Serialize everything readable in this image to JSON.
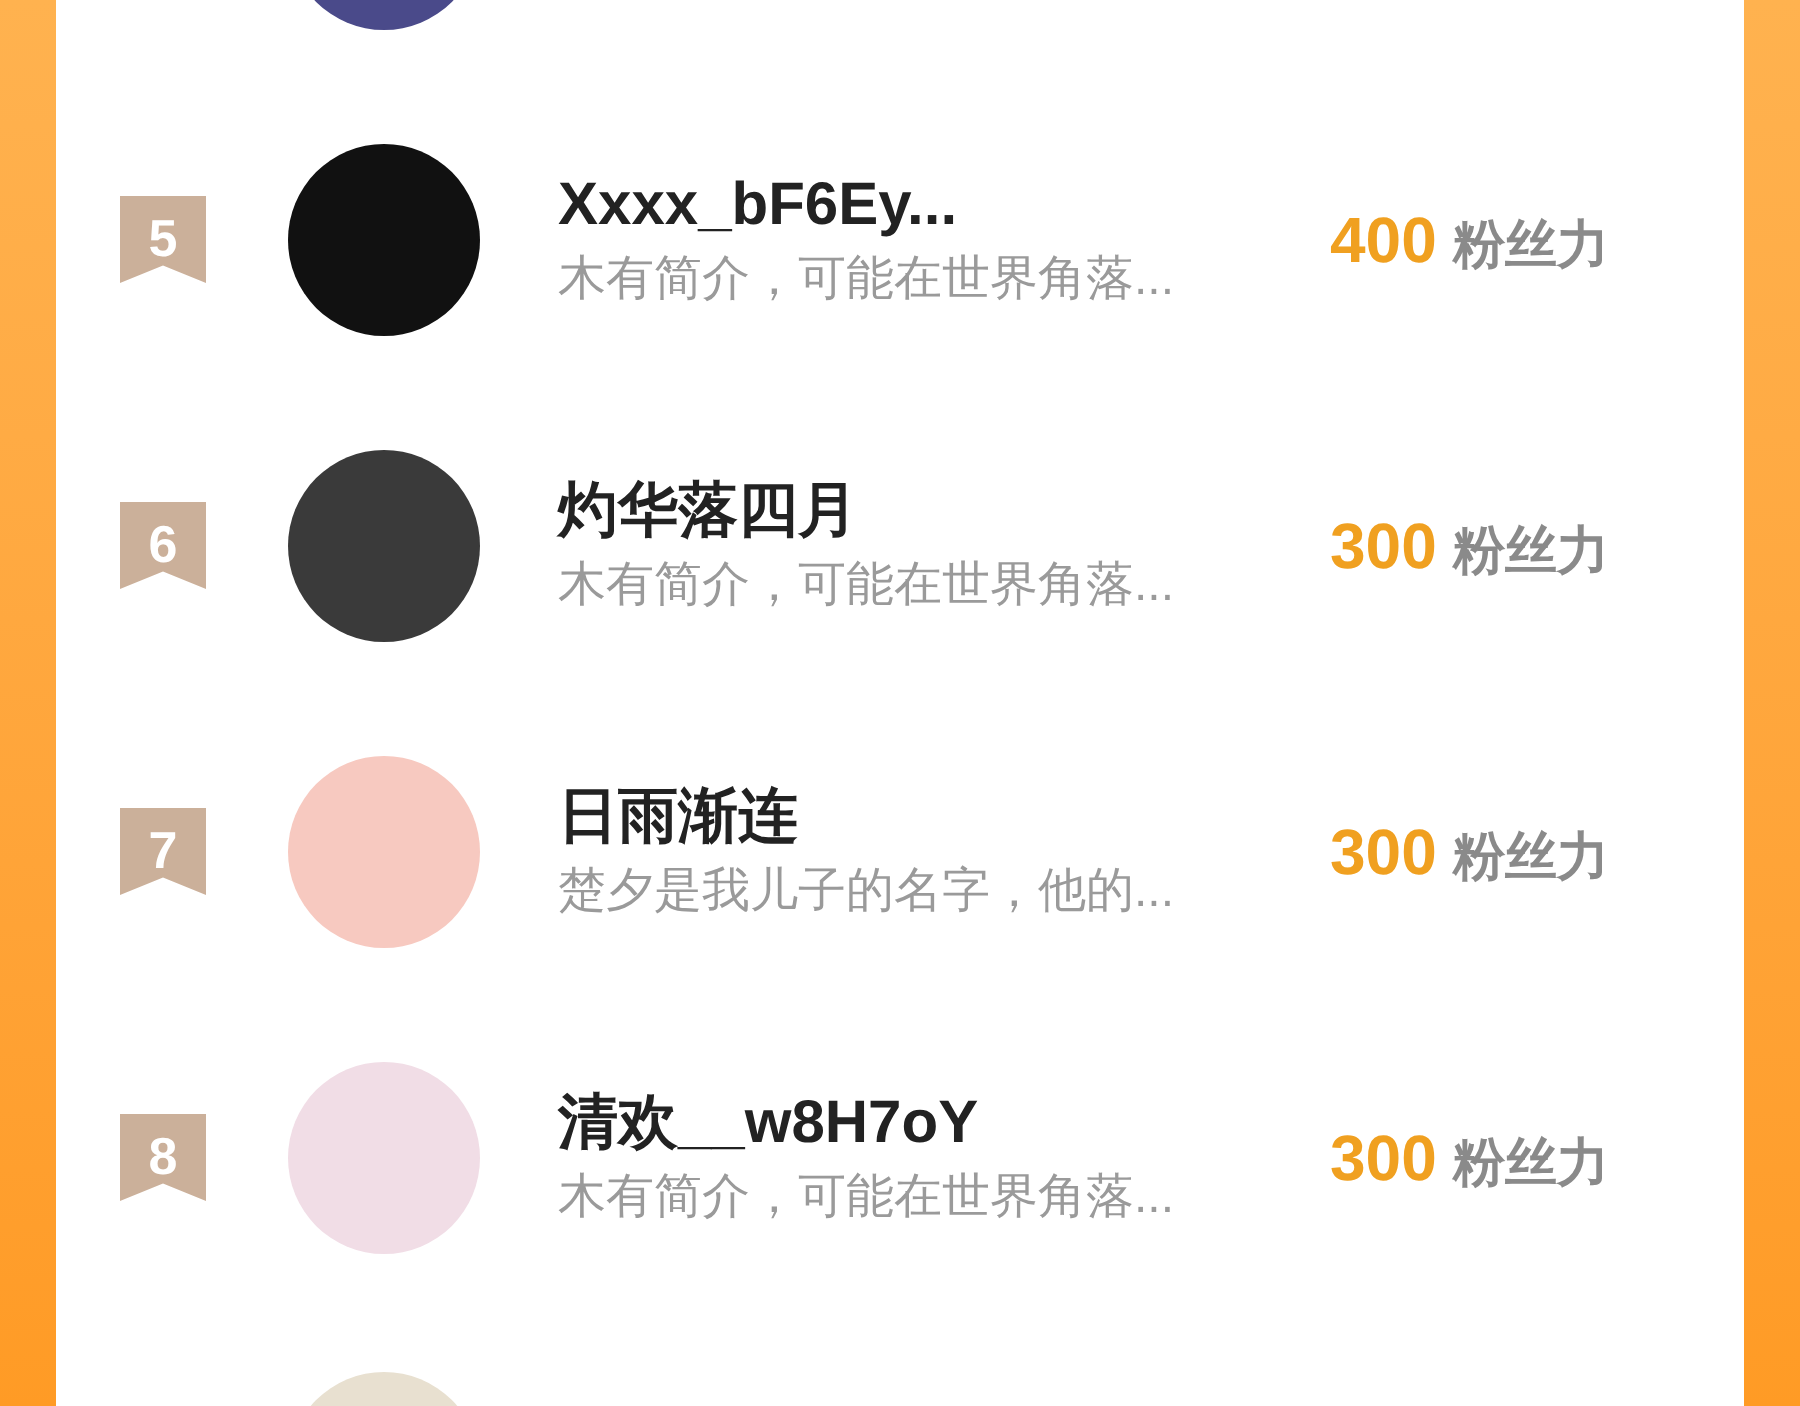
{
  "rows": [
    {
      "rank": "5",
      "name": "Xxxx_bF6Ey...",
      "bio": "木有简介，可能在世界角落...",
      "score": "400",
      "unit": "粉丝力"
    },
    {
      "rank": "6",
      "name": "灼华落四月",
      "bio": "木有简介，可能在世界角落...",
      "score": "300",
      "unit": "粉丝力"
    },
    {
      "rank": "7",
      "name": "日雨渐连",
      "bio": "楚夕是我儿子的名字，他的...",
      "score": "300",
      "unit": "粉丝力"
    },
    {
      "rank": "8",
      "name": "清欢__w8H7oY",
      "bio": "木有简介，可能在世界角落...",
      "score": "300",
      "unit": "粉丝力"
    }
  ]
}
